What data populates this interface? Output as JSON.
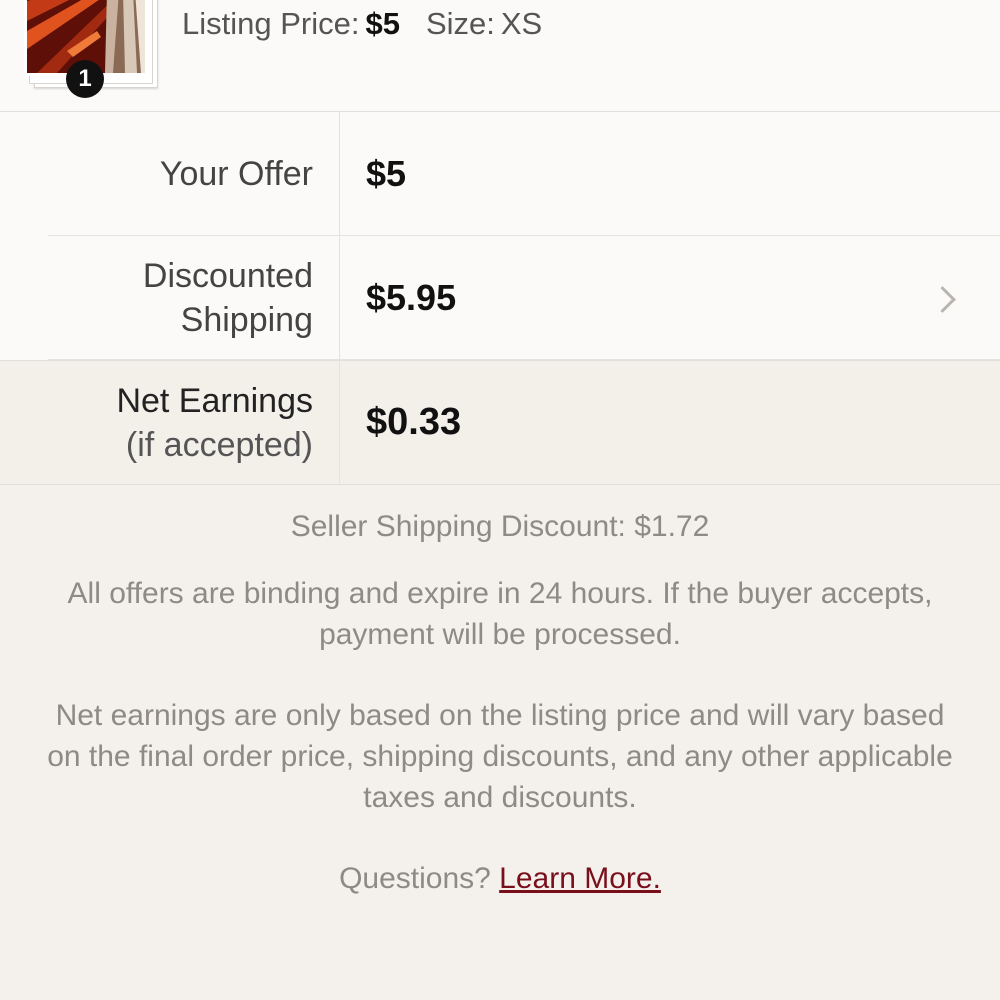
{
  "listing": {
    "price_label": "Listing Price:",
    "price_value": "$5",
    "size_label": "Size:",
    "size_value": "XS",
    "item_count": "1"
  },
  "offer": {
    "your_offer_label": "Your Offer",
    "your_offer_value": "$5",
    "shipping_label_line1": "Discounted",
    "shipping_label_line2": "Shipping",
    "shipping_value": "$5.95",
    "net_label_line1": "Net Earnings",
    "net_label_line2": "(if accepted)",
    "net_value": "$0.33"
  },
  "footer": {
    "seller_discount": "Seller Shipping Discount: $1.72",
    "binding_note": "All offers are binding and expire in 24 hours. If the buyer accepts, payment will be processed.",
    "earnings_note": "Net earnings are only based on the listing price and will vary based on the final order price, shipping discounts, and any other applicable taxes and discounts.",
    "questions_text": "Questions?",
    "learn_more_link": "Learn More."
  },
  "icons": {
    "chevron": "chevron-right-icon"
  },
  "colors": {
    "page_background": "#f4f1ed",
    "card_background": "#fcfaf8",
    "highlight_row": "#f3f0ea",
    "link": "#7a0f1c",
    "muted_text": "#8e8a86"
  }
}
